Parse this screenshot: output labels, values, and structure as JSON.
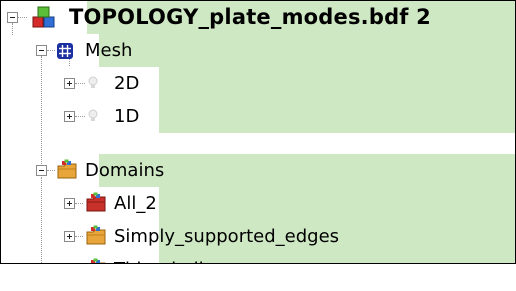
{
  "tree": {
    "root": {
      "label": "TOPOLOGY_plate_modes.bdf 2",
      "icon": "model-blocks-icon"
    },
    "mesh": {
      "label": "Mesh",
      "icon": "mesh-grid-icon"
    },
    "mesh_2d": {
      "label": "2D",
      "icon": "bulb-icon"
    },
    "mesh_1d": {
      "label": "1D",
      "icon": "bulb-icon"
    },
    "domains": {
      "label": "Domains",
      "icon": "domains-folder-icon"
    },
    "all_2": {
      "label": "All_2",
      "icon": "domain-folder-red-icon"
    },
    "ss_edges": {
      "label": "Simply_supported_edges",
      "icon": "domain-folder-icon"
    },
    "thin_shell": {
      "label": "Thin_shell",
      "icon": "domain-folder-icon"
    }
  },
  "colors": {
    "selection": "#cfe8c4",
    "mesh_icon": "#1a2fa0",
    "domain_folder": "#e8a53a"
  }
}
